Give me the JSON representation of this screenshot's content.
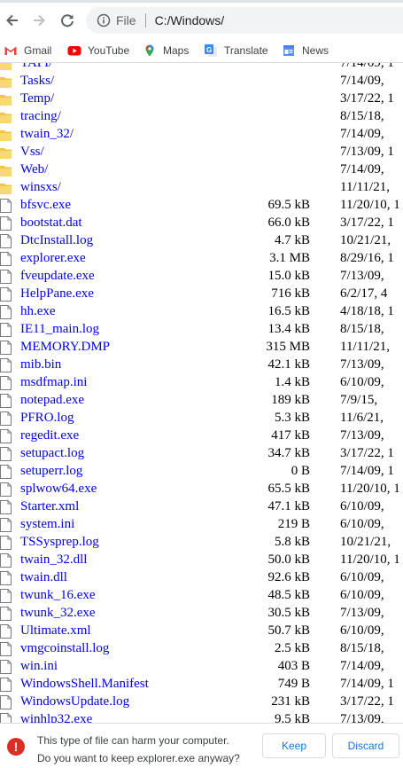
{
  "toolbar": {
    "url_scheme": "File",
    "url_path": "C:/Windows/"
  },
  "bookmarks": [
    {
      "label": "Gmail",
      "icon": "gmail-icon"
    },
    {
      "label": "YouTube",
      "icon": "youtube-icon"
    },
    {
      "label": "Maps",
      "icon": "maps-icon"
    },
    {
      "label": "Translate",
      "icon": "translate-icon"
    },
    {
      "label": "News",
      "icon": "news-icon"
    }
  ],
  "listing": {
    "rows": [
      {
        "name": "TAPI/",
        "size": "",
        "date": "7/14/09, 1",
        "type": "folder"
      },
      {
        "name": "Tasks/",
        "size": "",
        "date": "7/14/09,",
        "type": "folder"
      },
      {
        "name": "Temp/",
        "size": "",
        "date": "3/17/22, 1",
        "type": "folder"
      },
      {
        "name": "tracing/",
        "size": "",
        "date": "8/15/18,",
        "type": "folder"
      },
      {
        "name": "twain_32/",
        "size": "",
        "date": "7/14/09,",
        "type": "folder"
      },
      {
        "name": "Vss/",
        "size": "",
        "date": "7/13/09, 1",
        "type": "folder"
      },
      {
        "name": "Web/",
        "size": "",
        "date": "7/14/09,",
        "type": "folder"
      },
      {
        "name": "winsxs/",
        "size": "",
        "date": "11/11/21,",
        "type": "folder"
      },
      {
        "name": "bfsvc.exe",
        "size": "69.5 kB",
        "date": "11/20/10, 1",
        "type": "file"
      },
      {
        "name": "bootstat.dat",
        "size": "66.0 kB",
        "date": "3/17/22, 1",
        "type": "file"
      },
      {
        "name": "DtcInstall.log",
        "size": "4.7 kB",
        "date": "10/21/21,",
        "type": "file"
      },
      {
        "name": "explorer.exe",
        "size": "3.1 MB",
        "date": "8/29/16, 1",
        "type": "file"
      },
      {
        "name": "fveupdate.exe",
        "size": "15.0 kB",
        "date": "7/13/09,",
        "type": "file"
      },
      {
        "name": "HelpPane.exe",
        "size": "716 kB",
        "date": "6/2/17, 4",
        "type": "file"
      },
      {
        "name": "hh.exe",
        "size": "16.5 kB",
        "date": "4/18/18, 1",
        "type": "file"
      },
      {
        "name": "IE11_main.log",
        "size": "13.4 kB",
        "date": "8/15/18,",
        "type": "file"
      },
      {
        "name": "MEMORY.DMP",
        "size": "315 MB",
        "date": "11/11/21,",
        "type": "file"
      },
      {
        "name": "mib.bin",
        "size": "42.1 kB",
        "date": "7/13/09,",
        "type": "file"
      },
      {
        "name": "msdfmap.ini",
        "size": "1.4 kB",
        "date": "6/10/09,",
        "type": "file"
      },
      {
        "name": "notepad.exe",
        "size": "189 kB",
        "date": "7/9/15,",
        "type": "file"
      },
      {
        "name": "PFRO.log",
        "size": "5.3 kB",
        "date": "11/6/21,",
        "type": "file"
      },
      {
        "name": "regedit.exe",
        "size": "417 kB",
        "date": "7/13/09,",
        "type": "file"
      },
      {
        "name": "setupact.log",
        "size": "34.7 kB",
        "date": "3/17/22, 1",
        "type": "file"
      },
      {
        "name": "setuperr.log",
        "size": "0 B",
        "date": "7/14/09, 1",
        "type": "file"
      },
      {
        "name": "splwow64.exe",
        "size": "65.5 kB",
        "date": "11/20/10, 1",
        "type": "file"
      },
      {
        "name": "Starter.xml",
        "size": "47.1 kB",
        "date": "6/10/09,",
        "type": "file"
      },
      {
        "name": "system.ini",
        "size": "219 B",
        "date": "6/10/09,",
        "type": "file"
      },
      {
        "name": "TSSysprep.log",
        "size": "5.8 kB",
        "date": "10/21/21,",
        "type": "file"
      },
      {
        "name": "twain_32.dll",
        "size": "50.0 kB",
        "date": "11/20/10, 1",
        "type": "file"
      },
      {
        "name": "twain.dll",
        "size": "92.6 kB",
        "date": "6/10/09,",
        "type": "file"
      },
      {
        "name": "twunk_16.exe",
        "size": "48.5 kB",
        "date": "6/10/09,",
        "type": "file"
      },
      {
        "name": "twunk_32.exe",
        "size": "30.5 kB",
        "date": "7/13/09,",
        "type": "file"
      },
      {
        "name": "Ultimate.xml",
        "size": "50.7 kB",
        "date": "6/10/09,",
        "type": "file"
      },
      {
        "name": "vmgcoinstall.log",
        "size": "2.5 kB",
        "date": "8/15/18,",
        "type": "file"
      },
      {
        "name": "win.ini",
        "size": "403 B",
        "date": "7/14/09,",
        "type": "file"
      },
      {
        "name": "WindowsShell.Manifest",
        "size": "749 B",
        "date": "7/14/09, 1",
        "type": "file"
      },
      {
        "name": "WindowsUpdate.log",
        "size": "231 kB",
        "date": "3/17/22, 1",
        "type": "file"
      },
      {
        "name": "winhlp32.exe",
        "size": "9.5 kB",
        "date": "7/13/09,",
        "type": "file"
      }
    ]
  },
  "download_bar": {
    "message_line1": "This type of file can harm your computer.",
    "message_line2": "Do you want to keep explorer.exe anyway?",
    "keep_label": "Keep",
    "discard_label": "Discard"
  },
  "colors": {
    "link": "#0000ee",
    "folder": "#f4c14b",
    "warning": "#d93025",
    "button_text": "#1a73e8"
  }
}
